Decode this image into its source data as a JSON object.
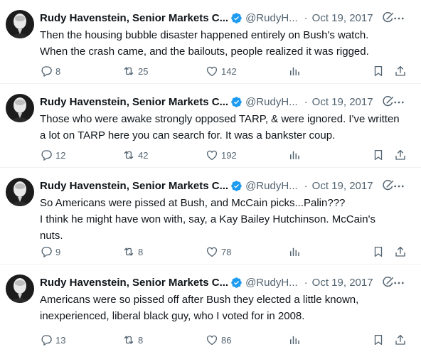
{
  "tweets": [
    {
      "author_name": "Rudy Havenstein, Senior Markets C...",
      "handle": "@RudyH...",
      "dot": "·",
      "date": "Oct 19, 2017",
      "text": "Then the housing bubble disaster happened entirely on Bush's watch.\nWhen the crash came, and the bailouts, people realized it was rigged.",
      "replies": "8",
      "reposts": "25",
      "likes": "142"
    },
    {
      "author_name": "Rudy Havenstein, Senior Markets C...",
      "handle": "@RudyH...",
      "dot": "·",
      "date": "Oct 19, 2017",
      "text": "Those who were awake strongly opposed TARP, & were ignored. I've written\na lot on TARP here you can search for. It was a bankster coup.",
      "replies": "12",
      "reposts": "42",
      "likes": "192"
    },
    {
      "author_name": "Rudy Havenstein, Senior Markets C...",
      "handle": "@RudyH...",
      "dot": "·",
      "date": "Oct 19, 2017",
      "text": "So Americans were pissed at Bush, and McCain picks...Palin???\nI think he might have won with, say, a Kay Bailey Hutchinson. McCain's\nnuts.",
      "replies": "9",
      "reposts": "8",
      "likes": "78"
    },
    {
      "author_name": "Rudy Havenstein, Senior Markets C...",
      "handle": "@RudyH...",
      "dot": "·",
      "date": "Oct 19, 2017",
      "text": "Americans were so pissed off after Bush they elected a little known,\ninexperienced, liberal black guy, who I voted for in 2008.",
      "replies": "13",
      "reposts": "8",
      "likes": "86"
    }
  ],
  "icons": {
    "reply": "reply-icon",
    "repost": "repost-icon",
    "like": "like-icon",
    "views": "views-icon",
    "bookmark": "bookmark-icon",
    "share": "share-icon",
    "verified": "verified-badge-icon",
    "grok": "grok-icon",
    "more": "more-icon"
  },
  "colors": {
    "text": "#0f1419",
    "secondary": "#536471",
    "verified": "#1d9bf0",
    "divider": "#eff3f4"
  }
}
